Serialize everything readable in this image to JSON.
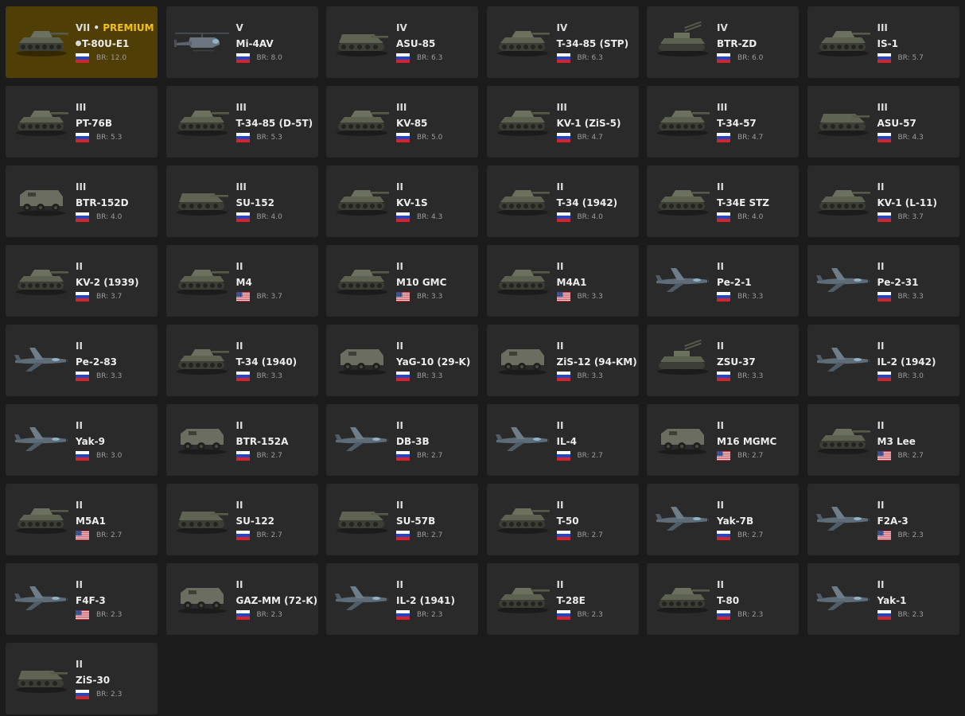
{
  "colors": {
    "background": "#1b1b1b",
    "card": "#2a2a2a",
    "premium_card": "#4f3e05",
    "premium_text": "#f2c01c"
  },
  "vehicles": [
    {
      "rank": "VII",
      "premium_label": "PREMIUM",
      "name": "T-80U-E1",
      "premium": true,
      "country": "ussr",
      "br": "BR: 12.0",
      "icon": "tank-icon"
    },
    {
      "rank": "V",
      "name": "Mi-4AV",
      "country": "ussr",
      "br": "BR: 8.0",
      "icon": "helicopter-icon"
    },
    {
      "rank": "IV",
      "name": "ASU-85",
      "country": "ussr",
      "br": "BR: 6.3",
      "icon": "spg-icon"
    },
    {
      "rank": "IV",
      "name": "T-34-85 (STP)",
      "country": "ussr",
      "br": "BR: 6.3",
      "icon": "tank-icon"
    },
    {
      "rank": "IV",
      "name": "BTR-ZD",
      "country": "ussr",
      "br": "BR: 6.0",
      "icon": "spaa-icon"
    },
    {
      "rank": "III",
      "name": "IS-1",
      "country": "ussr",
      "br": "BR: 5.7",
      "icon": "tank-icon"
    },
    {
      "rank": "III",
      "name": "PT-76B",
      "country": "ussr",
      "br": "BR: 5.3",
      "icon": "tank-icon"
    },
    {
      "rank": "III",
      "name": "T-34-85 (D-5T)",
      "country": "ussr",
      "br": "BR: 5.3",
      "icon": "tank-icon"
    },
    {
      "rank": "III",
      "name": "KV-85",
      "country": "ussr",
      "br": "BR: 5.0",
      "icon": "tank-icon"
    },
    {
      "rank": "III",
      "name": "KV-1 (ZiS-5)",
      "country": "ussr",
      "br": "BR: 4.7",
      "icon": "tank-icon"
    },
    {
      "rank": "III",
      "name": "T-34-57",
      "country": "ussr",
      "br": "BR: 4.7",
      "icon": "tank-icon"
    },
    {
      "rank": "III",
      "name": "ASU-57",
      "country": "ussr",
      "br": "BR: 4.3",
      "icon": "spg-icon"
    },
    {
      "rank": "III",
      "name": "BTR-152D",
      "country": "ussr",
      "br": "BR: 4.0",
      "icon": "truck-icon"
    },
    {
      "rank": "III",
      "name": "SU-152",
      "country": "ussr",
      "br": "BR: 4.0",
      "icon": "spg-icon"
    },
    {
      "rank": "II",
      "name": "KV-1S",
      "country": "ussr",
      "br": "BR: 4.3",
      "icon": "tank-icon"
    },
    {
      "rank": "II",
      "name": "T-34 (1942)",
      "country": "ussr",
      "br": "BR: 4.0",
      "icon": "tank-icon"
    },
    {
      "rank": "II",
      "name": "T-34E STZ",
      "country": "ussr",
      "br": "BR: 4.0",
      "icon": "tank-icon"
    },
    {
      "rank": "II",
      "name": "KV-1 (L-11)",
      "country": "ussr",
      "br": "BR: 3.7",
      "icon": "tank-icon"
    },
    {
      "rank": "II",
      "name": "KV-2 (1939)",
      "country": "ussr",
      "br": "BR: 3.7",
      "icon": "tank-icon"
    },
    {
      "rank": "II",
      "name": "M4",
      "country": "usa",
      "br": "BR: 3.7",
      "icon": "tank-icon"
    },
    {
      "rank": "II",
      "name": "M10 GMC",
      "country": "usa",
      "br": "BR: 3.3",
      "icon": "tank-icon"
    },
    {
      "rank": "II",
      "name": "M4A1",
      "country": "usa",
      "br": "BR: 3.3",
      "icon": "tank-icon"
    },
    {
      "rank": "II",
      "name": "Pe-2-1",
      "country": "ussr",
      "br": "BR: 3.3",
      "icon": "plane-icon"
    },
    {
      "rank": "II",
      "name": "Pe-2-31",
      "country": "ussr",
      "br": "BR: 3.3",
      "icon": "plane-icon"
    },
    {
      "rank": "II",
      "name": "Pe-2-83",
      "country": "ussr",
      "br": "BR: 3.3",
      "icon": "plane-icon"
    },
    {
      "rank": "II",
      "name": "T-34 (1940)",
      "country": "ussr",
      "br": "BR: 3.3",
      "icon": "tank-icon"
    },
    {
      "rank": "II",
      "name": "YaG-10 (29-K)",
      "country": "ussr",
      "br": "BR: 3.3",
      "icon": "truck-icon"
    },
    {
      "rank": "II",
      "name": "ZiS-12 (94-KM)",
      "country": "ussr",
      "br": "BR: 3.3",
      "icon": "truck-icon"
    },
    {
      "rank": "II",
      "name": "ZSU-37",
      "country": "ussr",
      "br": "BR: 3.3",
      "icon": "spaa-icon"
    },
    {
      "rank": "II",
      "name": "IL-2 (1942)",
      "country": "ussr",
      "br": "BR: 3.0",
      "icon": "plane-icon"
    },
    {
      "rank": "II",
      "name": "Yak-9",
      "country": "ussr",
      "br": "BR: 3.0",
      "icon": "plane-icon"
    },
    {
      "rank": "II",
      "name": "BTR-152A",
      "country": "ussr",
      "br": "BR: 2.7",
      "icon": "truck-icon"
    },
    {
      "rank": "II",
      "name": "DB-3B",
      "country": "ussr",
      "br": "BR: 2.7",
      "icon": "plane-icon"
    },
    {
      "rank": "II",
      "name": "IL-4",
      "country": "ussr",
      "br": "BR: 2.7",
      "icon": "plane-icon"
    },
    {
      "rank": "II",
      "name": "M16 MGMC",
      "country": "usa",
      "br": "BR: 2.7",
      "icon": "truck-icon"
    },
    {
      "rank": "II",
      "name": "M3 Lee",
      "country": "usa",
      "br": "BR: 2.7",
      "icon": "tank-icon"
    },
    {
      "rank": "II",
      "name": "M5A1",
      "country": "usa",
      "br": "BR: 2.7",
      "icon": "tank-icon"
    },
    {
      "rank": "II",
      "name": "SU-122",
      "country": "ussr",
      "br": "BR: 2.7",
      "icon": "spg-icon"
    },
    {
      "rank": "II",
      "name": "SU-57B",
      "country": "ussr",
      "br": "BR: 2.7",
      "icon": "spg-icon"
    },
    {
      "rank": "II",
      "name": "T-50",
      "country": "ussr",
      "br": "BR: 2.7",
      "icon": "tank-icon"
    },
    {
      "rank": "II",
      "name": "Yak-7B",
      "country": "ussr",
      "br": "BR: 2.7",
      "icon": "plane-icon"
    },
    {
      "rank": "II",
      "name": "F2A-3",
      "country": "usa",
      "br": "BR: 2.3",
      "icon": "plane-icon"
    },
    {
      "rank": "II",
      "name": "F4F-3",
      "country": "usa",
      "br": "BR: 2.3",
      "icon": "plane-icon"
    },
    {
      "rank": "II",
      "name": "GAZ-MM (72-K)",
      "country": "ussr",
      "br": "BR: 2.3",
      "icon": "truck-icon"
    },
    {
      "rank": "II",
      "name": "IL-2 (1941)",
      "country": "ussr",
      "br": "BR: 2.3",
      "icon": "plane-icon"
    },
    {
      "rank": "II",
      "name": "T-28E",
      "country": "ussr",
      "br": "BR: 2.3",
      "icon": "tank-icon"
    },
    {
      "rank": "II",
      "name": "T-80",
      "country": "ussr",
      "br": "BR: 2.3",
      "icon": "tank-icon"
    },
    {
      "rank": "II",
      "name": "Yak-1",
      "country": "ussr",
      "br": "BR: 2.3",
      "icon": "plane-icon"
    },
    {
      "rank": "II",
      "name": "ZiS-30",
      "country": "ussr",
      "br": "BR: 2.3",
      "icon": "spg-icon"
    }
  ]
}
